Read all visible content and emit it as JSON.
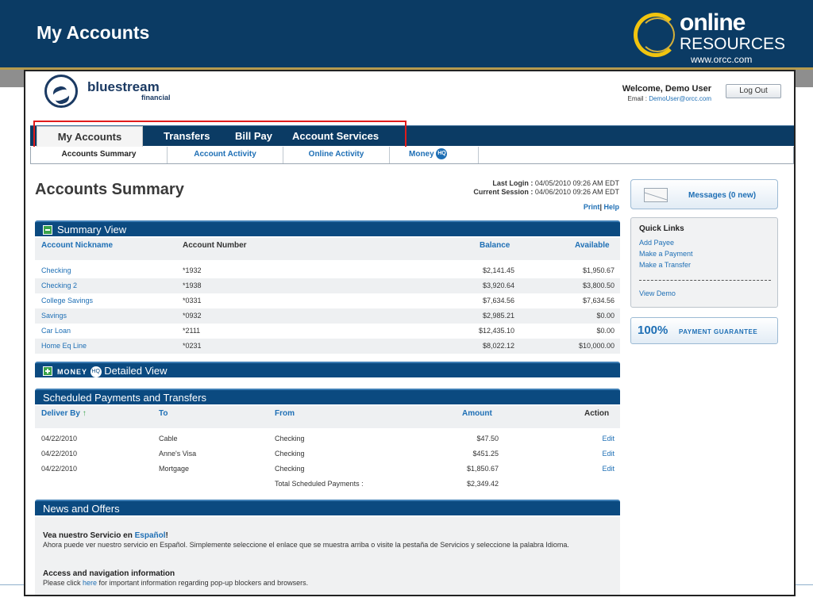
{
  "slide": {
    "title": "My Accounts",
    "logo_top": "online",
    "logo_bottom": "RESOURCES",
    "logo_url": "www.orcc.com"
  },
  "bank": {
    "name": "bluestream",
    "sub": "financial"
  },
  "user": {
    "welcome": "Welcome, Demo User",
    "email_label": "Email :",
    "email": "DemoUser@orcc.com",
    "logout": "Log Out"
  },
  "nav": {
    "tabs": [
      "My Accounts",
      "Transfers",
      "Bill Pay",
      "Account Services"
    ],
    "subnav": [
      "Accounts Summary",
      "Account Activity",
      "Online Activity",
      "Money"
    ],
    "hq_badge": "HQ"
  },
  "page": {
    "heading": "Accounts Summary",
    "last_login_label": "Last Login :",
    "last_login": "04/05/2010 09:26 AM EDT",
    "current_session_label": "Current Session :",
    "current_session": "04/06/2010 09:26 AM EDT",
    "print": "Print",
    "help": "Help"
  },
  "summary": {
    "title": "Summary View",
    "columns": [
      "Account Nickname",
      "Account Number",
      "Balance",
      "Available"
    ],
    "rows": [
      {
        "nickname": "Checking",
        "number": "*1932",
        "balance": "$2,141.45",
        "available": "$1,950.67"
      },
      {
        "nickname": "Checking 2",
        "number": "*1938",
        "balance": "$3,920.64",
        "available": "$3,800.50"
      },
      {
        "nickname": "College Savings",
        "number": "*0331",
        "balance": "$7,634.56",
        "available": "$7,634.56"
      },
      {
        "nickname": "Savings",
        "number": "*0932",
        "balance": "$2,985.21",
        "available": "$0.00"
      },
      {
        "nickname": "Car Loan",
        "number": "*2111",
        "balance": "$12,435.10",
        "available": "$0.00"
      },
      {
        "nickname": "Home Eq Line",
        "number": "*0231",
        "balance": "$8,022.12",
        "available": "$10,000.00"
      }
    ]
  },
  "money_hq": {
    "brand": "MONEY",
    "title": "Detailed View"
  },
  "scheduled": {
    "title": "Scheduled Payments and Transfers",
    "columns": [
      "Deliver By",
      "To",
      "From",
      "Amount",
      "Action"
    ],
    "rows": [
      {
        "date": "04/22/2010",
        "to": "Cable",
        "from": "Checking",
        "amount": "$47.50",
        "action": "Edit"
      },
      {
        "date": "04/22/2010",
        "to": "Anne's Visa",
        "from": "Checking",
        "amount": "$451.25",
        "action": "Edit"
      },
      {
        "date": "04/22/2010",
        "to": "Mortgage",
        "from": "Checking",
        "amount": "$1,850.67",
        "action": "Edit"
      }
    ],
    "total_label": "Total Scheduled Payments :",
    "total": "$2,349.42"
  },
  "sidebar": {
    "messages": "Messages (0 new)",
    "quick_links_title": "Quick Links",
    "quick_links": [
      "Add Payee",
      "Make a Payment",
      "Make a Transfer"
    ],
    "view_demo": "View Demo",
    "guarantee_pct": "100%",
    "guarantee_text": "PAYMENT GUARANTEE"
  },
  "news": {
    "title": "News and Offers",
    "item1_title": "Vea nuestro Servicio en ",
    "item1_link": "Español",
    "item1_bang": "!",
    "item1_text": "Ahora puede ver nuestro servicio en Español. Simplemente seleccione el enlace que se muestra arriba o visite la pestaña de Servicios y seleccione la palabra Idioma.",
    "item2_title": "Access and navigation information",
    "item2_pre": "Please click ",
    "item2_link": "here",
    "item2_post": " for important information regarding pop-up blockers and browsers."
  },
  "colors": {
    "header_navy": "#0b3b64",
    "link_blue": "#1e6fb5",
    "highlight_red": "#e01b1b",
    "gold": "#b59b4f"
  }
}
